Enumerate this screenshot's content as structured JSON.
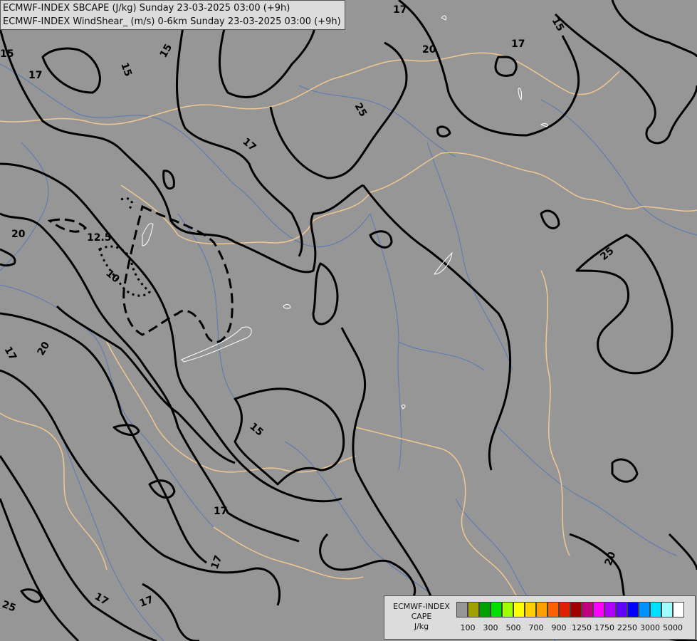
{
  "title": {
    "line1": "ECMWF-INDEX SBCAPE (J/kg) Sunday 23-03-2025 03:00 (+9h)",
    "line2": "ECMWF-INDEX WindShear_ (m/s) 0-6km Sunday 23-03-2025 03:00 (+9h)"
  },
  "legend": {
    "model": "ECMWF-INDEX",
    "field": "CAPE",
    "unit": "J/kg",
    "colors": [
      "#969696",
      "#a0a000",
      "#00a000",
      "#00e000",
      "#a0ff00",
      "#ffff00",
      "#ffd000",
      "#ffa000",
      "#ff6000",
      "#e02000",
      "#a00000",
      "#c00080",
      "#ff00ff",
      "#b000ff",
      "#6000ff",
      "#0000ff",
      "#0090ff",
      "#00e0ff",
      "#a0ffff",
      "#ffffff"
    ],
    "tick_labels": [
      "100",
      "300",
      "500",
      "700",
      "900",
      "1250",
      "1750",
      "2250",
      "3000",
      "5000"
    ]
  },
  "contour_labels": [
    {
      "text": "17"
    },
    {
      "text": "20"
    },
    {
      "text": "25"
    },
    {
      "text": "17"
    },
    {
      "text": "15"
    },
    {
      "text": "15"
    },
    {
      "text": "17"
    },
    {
      "text": "15"
    },
    {
      "text": "17"
    },
    {
      "text": "15"
    },
    {
      "text": "20"
    },
    {
      "text": "12.5"
    },
    {
      "text": "10"
    },
    {
      "text": "25"
    },
    {
      "text": "17"
    },
    {
      "text": "20"
    },
    {
      "text": "15"
    },
    {
      "text": "17"
    },
    {
      "text": "17"
    },
    {
      "text": "17"
    },
    {
      "text": "17"
    },
    {
      "text": "20"
    },
    {
      "text": "25"
    }
  ],
  "colors": {
    "background": "#969696",
    "border": "#f0c890",
    "river": "#5a78b4",
    "contour": "#000000",
    "cape_outline": "#ffffff"
  }
}
